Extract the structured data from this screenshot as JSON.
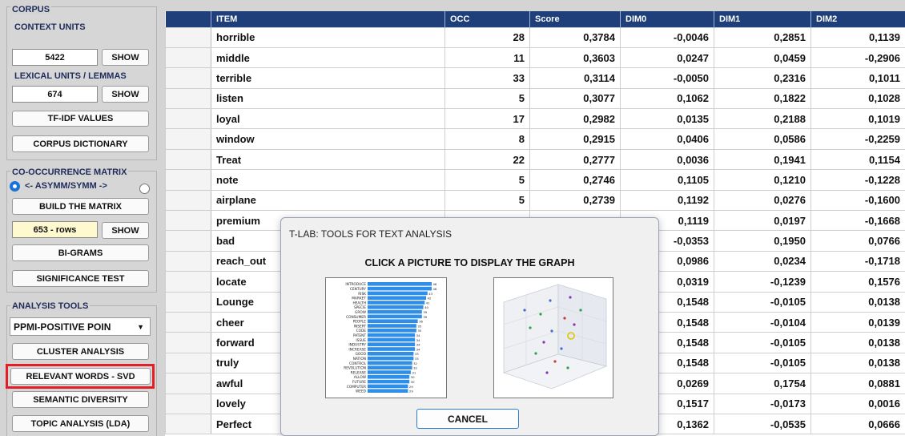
{
  "corpus": {
    "title": "CORPUS",
    "context_units_label": "CONTEXT UNITS",
    "context_units_value": "5422",
    "lexical_units_label": "LEXICAL UNITS / LEMMAS",
    "lexical_units_value": "674",
    "show_label": "SHOW",
    "tfidf_label": "TF-IDF VALUES",
    "dictionary_label": "CORPUS DICTIONARY"
  },
  "cooc": {
    "title": "CO-OCCURRENCE MATRIX",
    "radio_label": "<- ASYMM/SYMM ->",
    "build_label": "BUILD THE MATRIX",
    "rows_value": "653 - rows",
    "show_label": "SHOW",
    "bigrams_label": "BI-GRAMS",
    "significance_label": "SIGNIFICANCE TEST"
  },
  "analysis": {
    "title": "ANALYSIS TOOLS",
    "select_value": "PPMI-POSITIVE POIN",
    "cluster_label": "CLUSTER ANALYSIS",
    "relevant_label": "RELEVANT WORDS - SVD",
    "semantic_label": "SEMANTIC DIVERSITY",
    "topic_label": "TOPIC ANALYSIS (LDA)"
  },
  "table": {
    "headers": [
      "ITEM",
      "OCC",
      "Score",
      "DIM0",
      "DIM1",
      "DIM2"
    ],
    "rows": [
      [
        "horrible",
        "28",
        "0,3784",
        "-0,0046",
        "0,2851",
        "0,1139"
      ],
      [
        "middle",
        "11",
        "0,3603",
        "0,0247",
        "0,0459",
        "-0,2906"
      ],
      [
        "terrible",
        "33",
        "0,3114",
        "-0,0050",
        "0,2316",
        "0,1011"
      ],
      [
        "listen",
        "5",
        "0,3077",
        "0,1062",
        "0,1822",
        "0,1028"
      ],
      [
        "loyal",
        "17",
        "0,2982",
        "0,0135",
        "0,2188",
        "0,1019"
      ],
      [
        "window",
        "8",
        "0,2915",
        "0,0406",
        "0,0586",
        "-0,2259"
      ],
      [
        "Treat",
        "22",
        "0,2777",
        "0,0036",
        "0,1941",
        "0,1154"
      ],
      [
        "note",
        "5",
        "0,2746",
        "0,1105",
        "0,1210",
        "-0,1228"
      ],
      [
        "airplane",
        "5",
        "0,2739",
        "0,1192",
        "0,0276",
        "-0,1600"
      ],
      [
        "premium",
        "",
        "",
        "0,1119",
        "0,0197",
        "-0,1668"
      ],
      [
        "bad",
        "",
        "",
        "-0,0353",
        "0,1950",
        "0,0766"
      ],
      [
        "reach_out",
        "",
        "",
        "0,0986",
        "0,0234",
        "-0,1718"
      ],
      [
        "locate",
        "",
        "",
        "0,0319",
        "-0,1239",
        "0,1576"
      ],
      [
        "Lounge",
        "",
        "",
        "0,1548",
        "-0,0105",
        "0,0138"
      ],
      [
        "cheer",
        "",
        "",
        "0,1548",
        "-0,0104",
        "0,0139"
      ],
      [
        "forward",
        "",
        "",
        "0,1548",
        "-0,0105",
        "0,0138"
      ],
      [
        "truly",
        "",
        "",
        "0,1548",
        "-0,0105",
        "0,0138"
      ],
      [
        "awful",
        "",
        "",
        "0,0269",
        "0,1754",
        "0,0881"
      ],
      [
        "lovely",
        "",
        "",
        "0,1517",
        "-0,0173",
        "0,0016"
      ],
      [
        "Perfect",
        "",
        "",
        "0,1362",
        "-0,0535",
        "0,0666"
      ]
    ]
  },
  "dialog": {
    "title": "T-LAB: TOOLS FOR TEXT ANALYSIS",
    "heading": "CLICK A PICTURE TO DISPLAY THE GRAPH",
    "cancel_label": "CANCEL",
    "bar_thumb": {
      "labels": [
        "INTRODUCE",
        "CENTURY",
        "RISK",
        "MARKET",
        "HEALTH",
        "SPECIE",
        "GROW",
        "CONSUMER",
        "PEOPLE",
        "INSERT",
        "CODE",
        "PATENT",
        "ISSUE",
        "INDUSTRY",
        "INCREASE",
        "GOOD",
        "NATION",
        "CONTROL",
        "REVOLUTION",
        "RELEASE",
        "ALLOW",
        "FUTURE",
        "COMPUTER",
        "WEED"
      ],
      "values": [
        46,
        46,
        43,
        42,
        41,
        40,
        39,
        39,
        36,
        35,
        35,
        34,
        34,
        34,
        34,
        33,
        33,
        32,
        32,
        31,
        30,
        30,
        29,
        29
      ]
    },
    "bar_color": "#2f8ee8"
  },
  "colors": {
    "header_bg": "#1f3f7a",
    "highlight": "#e21f26",
    "radio_on": "#1a73d9"
  }
}
